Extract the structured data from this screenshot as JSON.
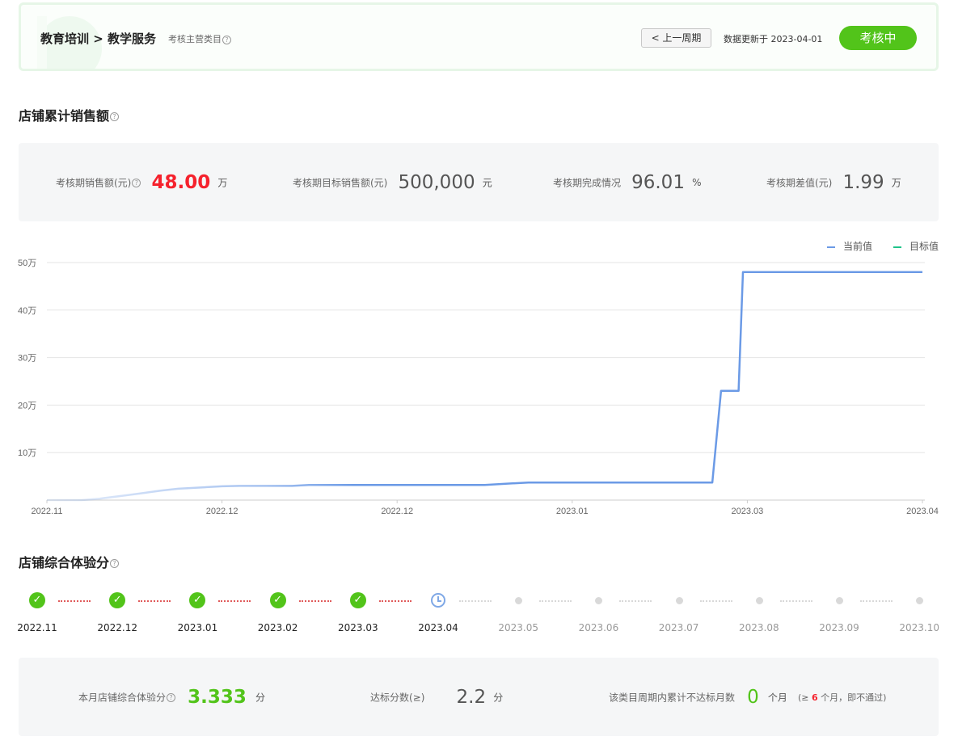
{
  "header": {
    "breadcrumb": "教育培训 > 教学服务",
    "subtitle": "考核主营类目",
    "prev_button": "< 上一周期",
    "update_text": "数据更新于 2023-04-01",
    "status": "考核中"
  },
  "sales": {
    "title": "店铺累计销售额",
    "stats": [
      {
        "label": "考核期销售额(元)",
        "value": "48.00",
        "unit": "万",
        "has_help": true,
        "highlight": "red"
      },
      {
        "label": "考核期目标销售额(元)",
        "value": "500,000",
        "unit": "元",
        "has_help": false,
        "highlight": "none"
      },
      {
        "label": "考核期完成情况",
        "value": "96.01",
        "unit": "%",
        "has_help": false,
        "highlight": "none"
      },
      {
        "label": "考核期差值(元)",
        "value": "1.99",
        "unit": "万",
        "has_help": false,
        "highlight": "none"
      }
    ]
  },
  "chart_data": {
    "type": "line",
    "x_tick_labels": [
      "2022.11",
      "2022.12",
      "2022.12",
      "2023.01",
      "2023.03",
      "2023.04"
    ],
    "y_tick_labels": [
      "10万",
      "20万",
      "30万",
      "40万",
      "50万"
    ],
    "ylim": [
      0,
      50
    ],
    "grid": true,
    "legend_position": "top-right",
    "series": [
      {
        "name": "当前值",
        "color": "#6b9ae6",
        "x": [
          0,
          0.04,
          0.06,
          0.09,
          0.11,
          0.13,
          0.15,
          0.18,
          0.2,
          0.22,
          0.24,
          0.26,
          0.28,
          0.3,
          0.32,
          0.34,
          0.36,
          0.38,
          0.4,
          0.42,
          0.44,
          0.46,
          0.5,
          0.55,
          0.6,
          0.65,
          0.7,
          0.74,
          0.76,
          0.77,
          0.78,
          0.79,
          0.795,
          0.8,
          0.82,
          1.0
        ],
        "y": [
          0,
          0,
          0.3,
          1.0,
          1.5,
          2.0,
          2.4,
          2.7,
          2.9,
          3.0,
          3.0,
          3.0,
          3.0,
          3.2,
          3.2,
          3.2,
          3.2,
          3.2,
          3.2,
          3.2,
          3.2,
          3.2,
          3.2,
          3.7,
          3.7,
          3.7,
          3.7,
          3.7,
          3.7,
          23.0,
          23.0,
          23.0,
          48.0,
          48.0,
          48.0,
          48.0
        ]
      },
      {
        "name": "目标值",
        "color": "#1fc38a",
        "x": [
          0,
          1.0
        ],
        "y": [
          50,
          50
        ]
      }
    ]
  },
  "experience": {
    "title": "店铺综合体验分",
    "months": [
      {
        "label": "2022.11",
        "status": "pass"
      },
      {
        "label": "2022.12",
        "status": "pass"
      },
      {
        "label": "2023.01",
        "status": "pass"
      },
      {
        "label": "2023.02",
        "status": "pass"
      },
      {
        "label": "2023.03",
        "status": "pass"
      },
      {
        "label": "2023.04",
        "status": "current"
      },
      {
        "label": "2023.05",
        "status": "future"
      },
      {
        "label": "2023.06",
        "status": "future"
      },
      {
        "label": "2023.07",
        "status": "future"
      },
      {
        "label": "2023.08",
        "status": "future"
      },
      {
        "label": "2023.09",
        "status": "future"
      },
      {
        "label": "2023.10",
        "status": "future"
      }
    ],
    "score_label": "本月店铺综合体验分",
    "score_value": "3.333",
    "score_unit": "分",
    "threshold_label": "达标分数(≥)",
    "threshold_value": "2.2",
    "threshold_unit": "分",
    "fail_label": "该类目周期内累计不达标月数",
    "fail_value": "0",
    "fail_unit": "个月",
    "fail_note_prefix": "(≥ ",
    "fail_note_num": "6",
    "fail_note_suffix": " 个月，即不通过)"
  },
  "colors": {
    "accent_green": "#52c41a",
    "red": "#f5222d",
    "line_blue": "#6b9ae6",
    "target_green": "#1fc38a"
  }
}
